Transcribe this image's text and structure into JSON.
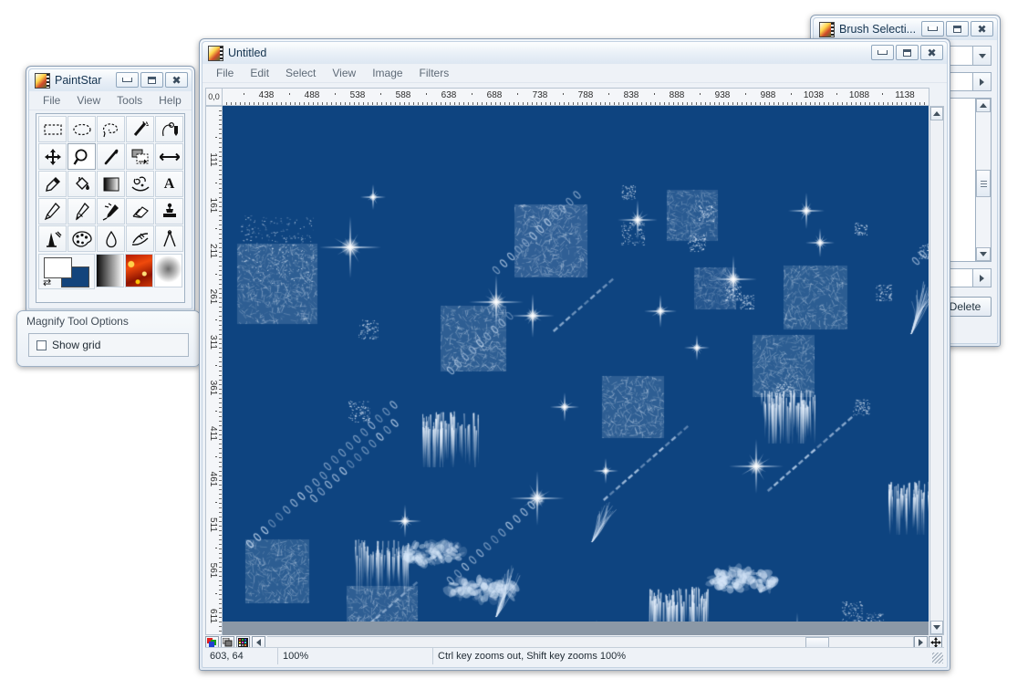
{
  "toolbox": {
    "title": "PaintStar",
    "icon": "paintstar-app-icon",
    "caption_buttons": [
      "minimize",
      "maximize",
      "close"
    ],
    "menu": [
      "File",
      "View",
      "Tools",
      "Help"
    ],
    "tools": [
      {
        "name": "rectangle-select-tool",
        "row": 1
      },
      {
        "name": "ellipse-select-tool",
        "row": 1
      },
      {
        "name": "lasso-select-tool",
        "row": 1
      },
      {
        "name": "magic-wand-tool",
        "row": 1
      },
      {
        "name": "path-tool",
        "row": 1
      },
      {
        "name": "move-tool",
        "row": 2
      },
      {
        "name": "magnify-tool",
        "row": 2,
        "selected": true
      },
      {
        "name": "line-tool",
        "row": 2
      },
      {
        "name": "crop-tool",
        "row": 2
      },
      {
        "name": "pan-tool",
        "row": 2
      },
      {
        "name": "eyedropper-tool",
        "row": 3
      },
      {
        "name": "paint-bucket-tool",
        "row": 3
      },
      {
        "name": "gradient-tool",
        "row": 3
      },
      {
        "name": "smudge-tool",
        "row": 3
      },
      {
        "name": "text-tool",
        "row": 3
      },
      {
        "name": "pencil-tool",
        "row": 4
      },
      {
        "name": "paintbrush-tool",
        "row": 4
      },
      {
        "name": "airbrush-tool",
        "row": 4
      },
      {
        "name": "eraser-tool",
        "row": 4
      },
      {
        "name": "clone-stamp-tool",
        "row": 4
      },
      {
        "name": "effects-brush-tool",
        "row": 5
      },
      {
        "name": "palette-tool",
        "row": 5
      },
      {
        "name": "blur-drop-tool",
        "row": 5
      },
      {
        "name": "dodge-burn-tool",
        "row": 5
      },
      {
        "name": "measure-tool",
        "row": 5
      }
    ],
    "swatches": {
      "foreground": "#ffffff",
      "background": "#13447c",
      "gradient_label": "gradient-swatch",
      "texture_label": "texture-swatch",
      "brush_label": "brush-swatch"
    }
  },
  "tool_options": {
    "header": "Magnify Tool Options",
    "show_grid_label": "Show grid",
    "show_grid_checked": false
  },
  "brush_window": {
    "title": "Brush Selecti...",
    "caption_buttons": [
      "minimize",
      "maximize",
      "close"
    ],
    "delete_label": "Delete"
  },
  "document": {
    "title": "Untitled",
    "icon": "paintstar-app-icon",
    "caption_buttons": [
      "minimize",
      "maximize",
      "close"
    ],
    "menu": [
      "File",
      "Edit",
      "Select",
      "View",
      "Image",
      "Filters"
    ],
    "ruler": {
      "origin_label": "0,0",
      "horizontal_labels": [
        438,
        488,
        538,
        588,
        638,
        688,
        738,
        788,
        838,
        888,
        938,
        988,
        1038,
        1088,
        1138
      ],
      "vertical_labels": [
        111,
        161,
        211,
        261,
        311,
        361,
        411,
        461,
        511,
        561,
        611
      ]
    },
    "status": {
      "coordinates": "603, 64",
      "zoom": "100%",
      "hint": "Ctrl key zooms out, Shift key zooms 100%"
    },
    "canvas": {
      "background_color": "#0e4480",
      "stroke_color": "#ffffff"
    }
  }
}
